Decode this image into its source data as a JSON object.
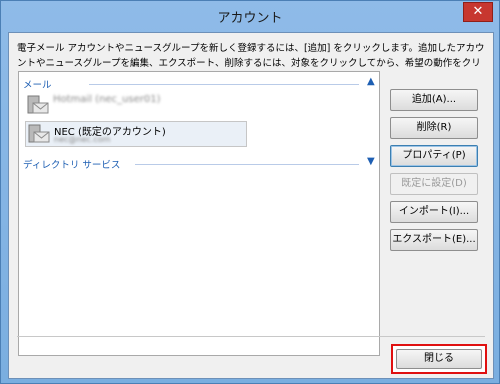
{
  "window": {
    "title": "アカウント",
    "close_glyph": "✕"
  },
  "description": "電子メール アカウントやニュースグループを新しく登録するには、[追加] をクリックします。追加したアカウントやニュースグループを編集、エクスポート、削除するには、対象をクリックしてから、希望の動作をクリックします。",
  "list": {
    "groups": [
      {
        "label": "メール",
        "chevron": "▲"
      },
      {
        "label": "ディレクトリ サービス",
        "chevron": "▼"
      }
    ],
    "accounts": [
      {
        "name": "Hotmail (nec_user01)",
        "sub": ""
      },
      {
        "name": "NEC (既定のアカウント)",
        "sub": "nec@nec.com"
      }
    ]
  },
  "buttons": {
    "add": "追加(A)...",
    "delete": "削除(R)",
    "properties": "プロパティ(P)",
    "set_default": "既定に設定(D)",
    "import": "インポート(I)...",
    "export": "エクスポート(E)...",
    "close": "閉じる"
  },
  "colors": {
    "highlight": "#e01010",
    "accent": "#1e5fb3"
  }
}
